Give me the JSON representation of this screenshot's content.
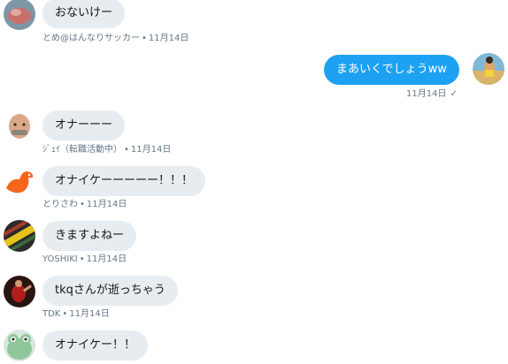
{
  "messages": [
    {
      "text": "おないけー",
      "sender": "とめ@はんなりサッカー",
      "time": "11月14日",
      "avatar_icon": "photo-avatar-icon"
    },
    {
      "text": "まあいくでしょうww",
      "time": "11月14日",
      "status_icon": "checkmark-icon",
      "avatar_icon": "photo-avatar-icon"
    },
    {
      "text": "オナーーー",
      "sender": "ｼﾞｪｲ（転職活動中）",
      "time": "11月14日",
      "avatar_icon": "photo-avatar-icon"
    },
    {
      "text": "オナイケーーーーー！！！",
      "sender": "とりさわ",
      "time": "11月14日",
      "avatar_icon": "bird-icon"
    },
    {
      "text": "きますよねー",
      "sender": "YOSHIKI",
      "time": "11月14日",
      "avatar_icon": "photo-avatar-icon"
    },
    {
      "text": "tkqさんが逝っちゃう",
      "sender": "TDK",
      "time": "11月14日",
      "avatar_icon": "photo-avatar-icon"
    },
    {
      "text": "オナイケー！！",
      "avatar_icon": "photo-avatar-icon"
    }
  ],
  "meta_separator": "•",
  "read_check": "✓",
  "colors": {
    "incoming_bubble": "#e6ecf0",
    "outgoing_bubble": "#1da1f2",
    "meta_text": "#657786"
  }
}
